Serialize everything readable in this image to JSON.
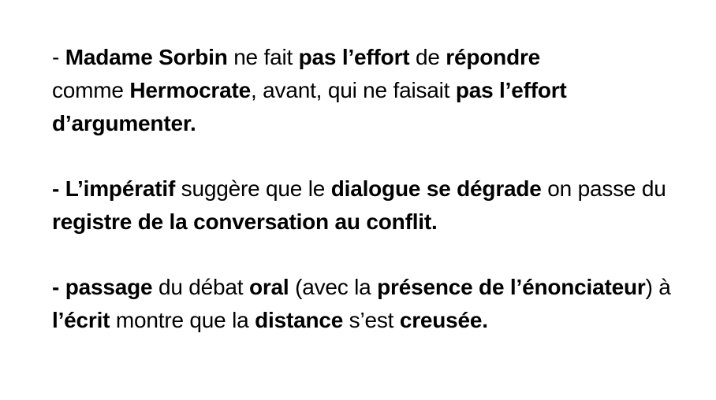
{
  "paragraphs": [
    {
      "segments": [
        {
          "text": "- ",
          "bold": false
        },
        {
          "text": "Madame Sorbin",
          "bold": true
        },
        {
          "text": " ne fait ",
          "bold": false
        },
        {
          "text": "pas l’effort",
          "bold": true
        },
        {
          "text": " de ",
          "bold": false
        },
        {
          "text": "répondre",
          "bold": true
        },
        {
          "text": " comme ",
          "bold": false
        },
        {
          "text": "Hermocrate",
          "bold": true
        },
        {
          "text": ", avant,  qui ne faisait ",
          "bold": false
        },
        {
          "text": "pas l’effort d’argumenter.",
          "bold": true
        }
      ]
    },
    {
      "segments": [
        {
          "text": "- L’impératif",
          "bold": true
        },
        {
          "text": " suggère que le ",
          "bold": false
        },
        {
          "text": "dialogue se dégrade",
          "bold": true
        },
        {
          "text": " on passe du ",
          "bold": false
        },
        {
          "text": "registre de la conversation au conflit.",
          "bold": true
        }
      ]
    },
    {
      "segments": [
        {
          "text": "- passage",
          "bold": true
        },
        {
          "text": " du débat ",
          "bold": false
        },
        {
          "text": "oral",
          "bold": true
        },
        {
          "text": " (avec la ",
          "bold": false
        },
        {
          "text": "présence de l’énonciateur",
          "bold": true
        },
        {
          "text": ") à ",
          "bold": false
        },
        {
          "text": "l’écrit",
          "bold": true
        },
        {
          "text": " montre que la ",
          "bold": false
        },
        {
          "text": "distance",
          "bold": true
        },
        {
          "text": " s’est ",
          "bold": false
        },
        {
          "text": "creusée.",
          "bold": true
        }
      ]
    }
  ]
}
